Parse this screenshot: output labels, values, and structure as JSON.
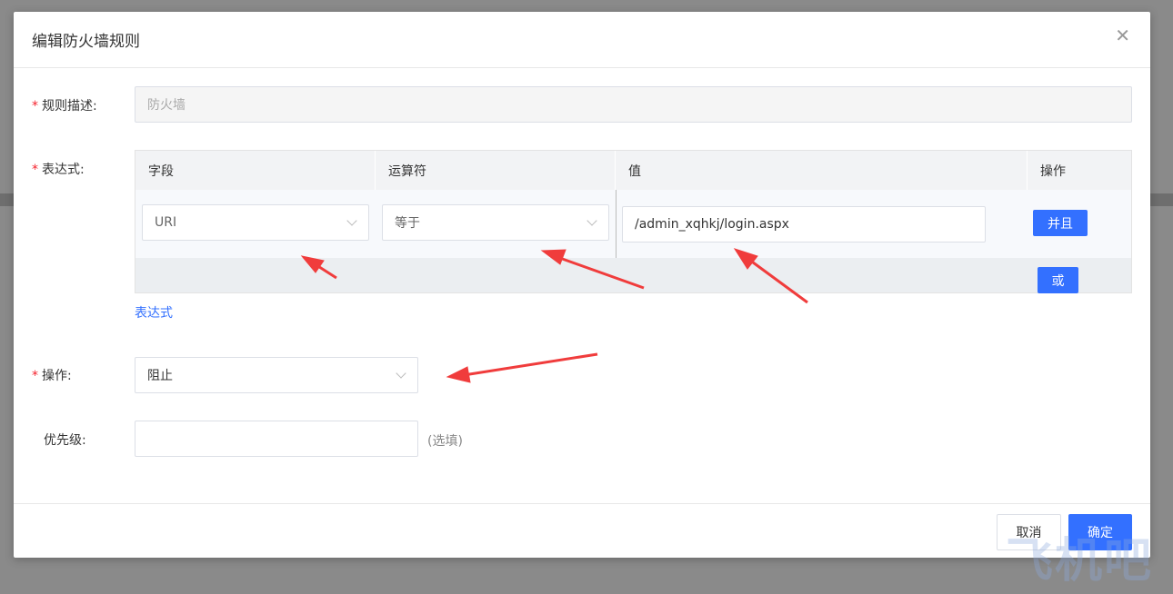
{
  "dialog": {
    "title": "编辑防火墙规则",
    "close_glyph": "✕"
  },
  "form": {
    "description": {
      "required_mark": "*",
      "label": "规则描述:",
      "value": "防火墙"
    },
    "expression": {
      "required_mark": "*",
      "label": "表达式:",
      "columns": [
        "字段",
        "运算符",
        "值",
        "操作"
      ],
      "row": {
        "field": "URI",
        "operator": "等于",
        "value": "/admin_xqhkj/login.aspx"
      },
      "and_button": "并且",
      "or_button": "或",
      "add_link": "表达式"
    },
    "action": {
      "required_mark": "*",
      "label": "操作:",
      "value": "阻止"
    },
    "priority": {
      "label": "优先级:",
      "value": "",
      "hint": "(选填)"
    }
  },
  "footer": {
    "cancel_label": "取消",
    "confirm_label": "确定"
  },
  "colors": {
    "primary": "#3370ff",
    "required": "#f5222d",
    "annotation_arrow": "#f03c3c"
  },
  "icons": {
    "close": "close-icon",
    "dropdown": "chevron-down-icon"
  },
  "watermark_text": "飞机吧"
}
